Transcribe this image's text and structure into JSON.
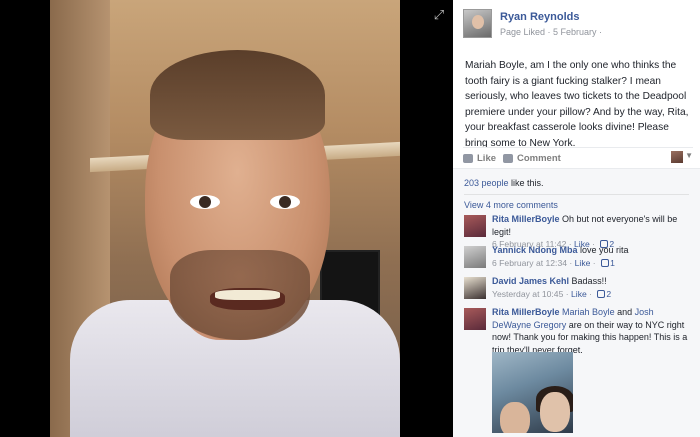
{
  "page": {
    "name": "Ryan Reynolds",
    "meta": "Page Liked · 5 February ·"
  },
  "post": {
    "text": "Mariah Boyle, am I the only one who thinks the tooth fairy is a giant fucking stalker? I mean seriously, who leaves two tickets to the Deadpool premiere under your pillow? And by the way, Rita, your breakfast casserole looks divine! Please bring some to New York."
  },
  "actions": {
    "like": "Like",
    "comment": "Comment"
  },
  "likes": {
    "count": "203 people",
    "suffix": " like this."
  },
  "more_comments": "View 4 more comments",
  "comments": [
    {
      "author": "Rita MillerBoyle",
      "text": " Oh but not everyone's will be legit!",
      "time": "6 February at 11:42",
      "like": "Like",
      "likes": "2"
    },
    {
      "author": "Yannick Ndong Mba",
      "text": " love you rita",
      "time": "6 February at 12:34",
      "like": "Like",
      "likes": "1"
    },
    {
      "author": "David James Kehl",
      "text": " Badass!!",
      "time": "Yesterday at 10:45",
      "like": "Like",
      "likes": "2"
    },
    {
      "author": "Rita MillerBoyle",
      "mention1": "Mariah Boyle",
      "and": " and ",
      "mention2": "Josh DeWayne Gregory",
      "text": " are on their way to NYC right now! Thank you for making this happen! This is a trip they'll never forget."
    }
  ],
  "icons": [
    "expand-icon",
    "like-icon",
    "comment-icon",
    "caret-down-icon",
    "thumbs-up-icon"
  ],
  "colors": {
    "link": "#3b5998",
    "muted": "#90949c",
    "panel_bg": "#f6f7f9"
  }
}
